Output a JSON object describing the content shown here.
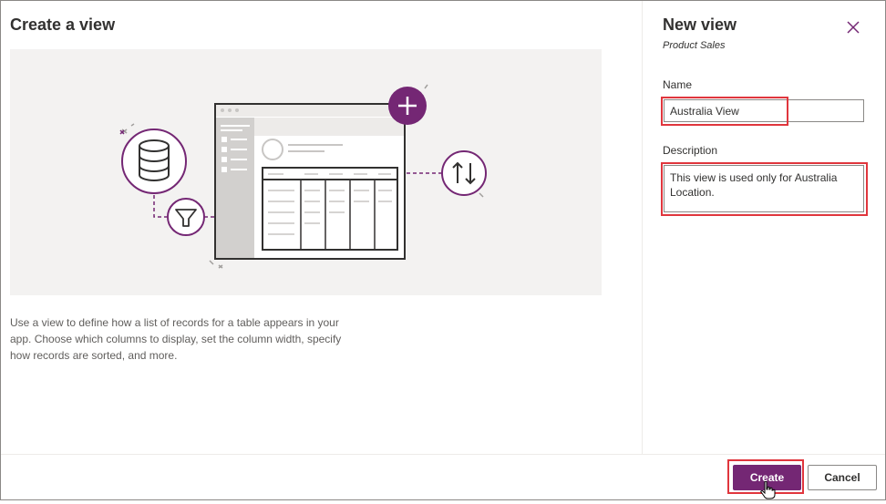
{
  "left_panel": {
    "title": "Create a view",
    "description": "Use a view to define how a list of records for a table appears in your app. Choose which columns to display, set the column width, specify how records are sorted, and more."
  },
  "right_panel": {
    "title": "New view",
    "subtitle": "Product Sales",
    "close_icon": "close-icon",
    "name_label": "Name",
    "name_value": "Australia View",
    "description_label": "Description",
    "description_value": "This view is used only for Australia Location."
  },
  "footer": {
    "create_label": "Create",
    "cancel_label": "Cancel"
  },
  "colors": {
    "accent": "#742774",
    "highlight": "#e0363d",
    "illustration_bg": "#f3f2f1"
  }
}
